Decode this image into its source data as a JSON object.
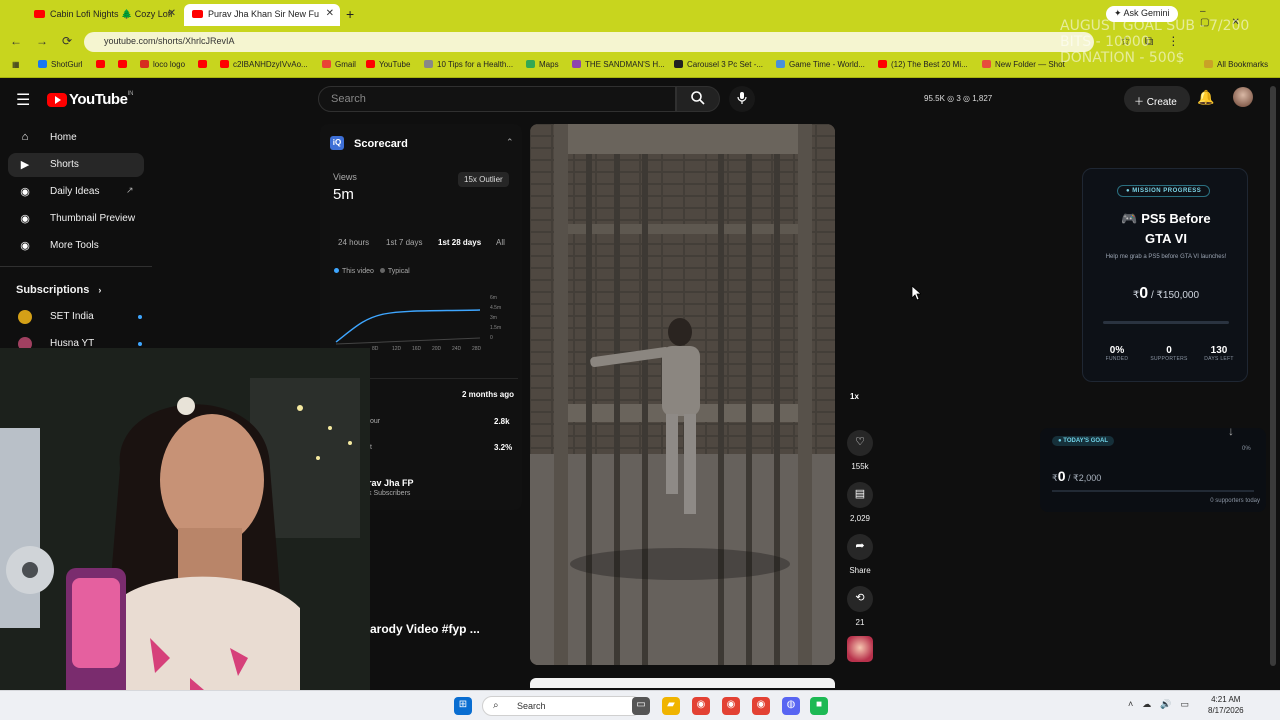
{
  "browser": {
    "tabs": [
      {
        "label": "Cabin Lofi Nights 🌲 Cozy Lofi",
        "active": false
      },
      {
        "label": "Purav Jha Khan Sir New Fu",
        "active": true
      }
    ],
    "new_tab_symbol": "+",
    "ask_gemini": "✦ Ask Gemini",
    "url": "youtube.com/shorts/XhrlcJRevIA",
    "bookmarks": [
      "ShotGurl",
      "loco logo",
      "c2IBANHDzyIVvAo...",
      "Gmail",
      "YouTube",
      "10 Tips for a Health...",
      "Maps",
      "THE SANDMAN'S H...",
      "Carousel 3 Pc Set -...",
      "Game Time - World...",
      "(12) The Best 20 Mi...",
      "New Folder — Shot"
    ],
    "all_bookmarks": "All Bookmarks"
  },
  "stream_overlay": {
    "line1": "AUGUST GOAL SUB - 7/200",
    "line2": "BITS - 10000",
    "line3": "DONATION - 500$"
  },
  "youtube": {
    "logo_text": "YouTube",
    "logo_region": "IN",
    "search_placeholder": "Search",
    "stats": "95.5K ◎ 3 ◎ 1,827",
    "create_label": "Create",
    "sidebar": {
      "items": [
        {
          "label": "Home",
          "icon": "home-icon",
          "glyph": "⌂"
        },
        {
          "label": "Shorts",
          "icon": "shorts-icon",
          "glyph": "▶"
        },
        {
          "label": "Daily Ideas",
          "icon": "ideas-icon",
          "glyph": "◉"
        },
        {
          "label": "Thumbnail Preview",
          "icon": "thumbnail-icon",
          "glyph": "◉"
        },
        {
          "label": "More Tools",
          "icon": "tools-icon",
          "glyph": "◉"
        }
      ],
      "subscriptions_label": "Subscriptions",
      "subscriptions": [
        "SET India",
        "Husna YT"
      ]
    },
    "scorecard": {
      "title": "Scorecard",
      "views_label": "Views",
      "views_value": "5m",
      "outlier": "15x Outlier",
      "ranges": [
        "24 hours",
        "1st 7 days",
        "1st 28 days",
        "All"
      ],
      "legend": [
        "This video",
        "Typical"
      ],
      "chart_y_ticks": [
        "6m",
        "4.5m",
        "3m",
        "1.5m",
        "0"
      ],
      "chart_x_ticks": [
        "8D",
        "12D",
        "16D",
        "20D",
        "24D",
        "28D"
      ],
      "posted": "2 months ago",
      "rows": [
        {
          "label": "our",
          "value": "2.8k"
        },
        {
          "label": "t",
          "value": "3.2%"
        }
      ],
      "channel": "rav Jha FP",
      "subscribers": "k Subscribers"
    },
    "video_title": "arody Video #fyp ...",
    "actions": {
      "speed": "1x",
      "likes": "155k",
      "comments": "2,029",
      "share": "Share",
      "remix": "21"
    }
  },
  "mission_card": {
    "badge": "● MISSION PROGRESS",
    "title": "🎮 PS5 Before GTA VI",
    "description": "Help me grab a PS5 before GTA VI launches!",
    "amount_current": "0",
    "amount_target": "/ ₹150,000",
    "currency": "₹",
    "funded": "0%",
    "funded_label": "FUNDED",
    "supporters": "0",
    "supporters_label": "SUPPORTERS",
    "days_left": "130",
    "days_left_label": "DAYS LEFT"
  },
  "goal_card": {
    "badge": "● TODAY'S GOAL",
    "amount_current": "0",
    "amount_target": "/ ₹2,000",
    "currency": "₹",
    "percent": "0%",
    "supporters": "0 supporters today",
    "arrow": "↓"
  },
  "taskbar": {
    "search_label": "Search",
    "time": "4:21 AM",
    "date": "8/17/2026"
  },
  "colors": {
    "browser_chrome": "#c8d51e",
    "yt_background": "#0f0f0f",
    "yt_red": "#ff0000",
    "accent_blue": "#3ea6ff"
  }
}
